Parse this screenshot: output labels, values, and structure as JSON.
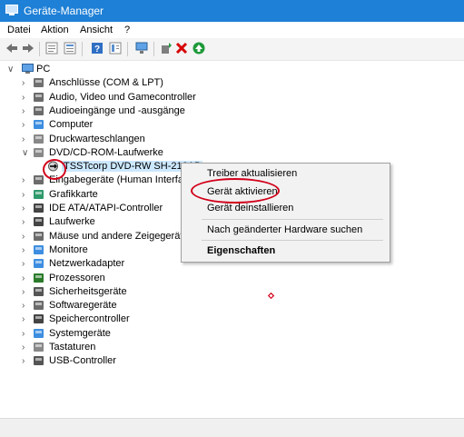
{
  "window": {
    "title": "Geräte-Manager"
  },
  "menu": [
    "Datei",
    "Aktion",
    "Ansicht",
    "?"
  ],
  "tree": {
    "root": "PC",
    "categories": [
      "Anschlüsse (COM & LPT)",
      "Audio, Video und Gamecontroller",
      "Audioeingänge und -ausgänge",
      "Computer",
      "Druckwarteschlangen",
      "DVD/CD-ROM-Laufwerke",
      "Eingabegeräte (Human Interface",
      "Grafikkarte",
      "IDE ATA/ATAPI-Controller",
      "Laufwerke",
      "Mäuse und andere Zeigegeräte",
      "Monitore",
      "Netzwerkadapter",
      "Prozessoren",
      "Sicherheitsgeräte",
      "Softwaregeräte",
      "Speichercontroller",
      "Systemgeräte",
      "Tastaturen",
      "USB-Controller"
    ],
    "dvd_child": "TSSTcorp DVD-RW SH-216AB"
  },
  "context_menu": {
    "update_driver": "Treiber aktualisieren",
    "enable_device": "Gerät aktivieren",
    "uninstall_device": "Gerät deinstallieren",
    "scan_hardware": "Nach geänderter Hardware suchen",
    "properties": "Eigenschaften"
  },
  "colors": {
    "title_bar": "#1e80d6",
    "highlight_ring": "#d2001a",
    "selection": "#cce8ff"
  }
}
